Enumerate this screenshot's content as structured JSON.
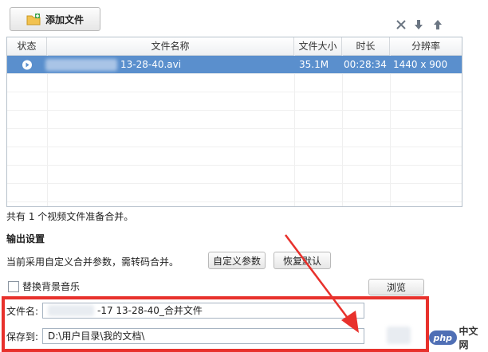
{
  "toolbar": {
    "add_file_label": "添加文件",
    "add_file_icon": "folder-add-icon",
    "remove_icon": "remove-icon",
    "move_down_icon": "arrow-down-icon",
    "move_up_icon": "arrow-up-icon"
  },
  "file_table": {
    "columns": [
      "状态",
      "文件名称",
      "文件大小",
      "时长",
      "分辨率"
    ],
    "rows": [
      {
        "status_icon": "play-icon",
        "name": "13-28-40.avi",
        "size": "35.1M",
        "duration": "00:28:34",
        "resolution": "1440 x 900",
        "selected": true
      }
    ]
  },
  "summary_text": "共有 1 个视频文件准备合并。",
  "output": {
    "title": "输出设置",
    "mode_text": "当前采用自定义合并参数，需转码合并。",
    "custom_params_button": "自定义参数",
    "restore_default_button": "恢复默认",
    "replace_bgm_label": "替换背景音乐",
    "browse_button": "浏览",
    "filename_label": "文件名:",
    "filename_value": "-17 13-28-40_合并文件",
    "save_to_label": "保存到:",
    "save_to_value": "D:\\用户目录\\我的文档\\"
  },
  "watermark": "php中文网",
  "colors": {
    "selection": "#5a8fcd",
    "highlight_red": "#e8312c"
  }
}
